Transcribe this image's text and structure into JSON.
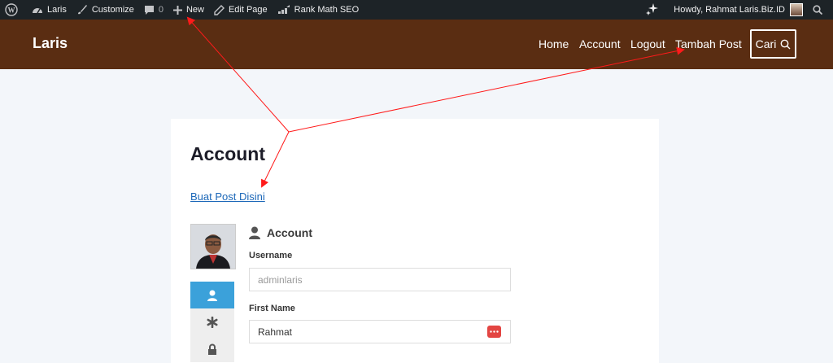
{
  "adminbar": {
    "site": "Laris",
    "customize": "Customize",
    "comments_count": "0",
    "new": "New",
    "edit_page": "Edit Page",
    "seo": "Rank Math SEO",
    "greeting": "Howdy, Rahmat Laris.Biz.ID"
  },
  "header": {
    "site_title": "Laris",
    "nav": [
      "Home",
      "Account",
      "Logout",
      "Tambah Post"
    ],
    "search_label": "Cari"
  },
  "page": {
    "title": "Account",
    "post_link": "Buat Post Disini",
    "section_title": "Account",
    "fields": [
      {
        "label": "Username",
        "value": "adminlaris"
      },
      {
        "label": "First Name",
        "value": "Rahmat"
      }
    ]
  },
  "colors": {
    "adminbar_bg": "#1d2327",
    "header_bg": "#5a2d12",
    "accent_tab": "#3ba1da",
    "link": "#1b67b8",
    "arrow": "#ff1a1a"
  }
}
